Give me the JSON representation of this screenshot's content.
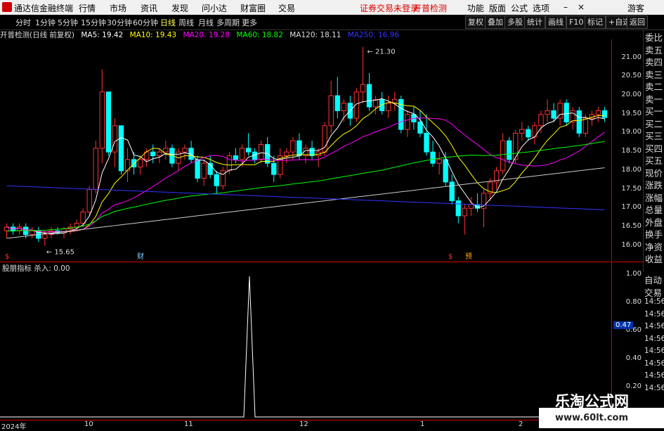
{
  "app": {
    "name": "通达信金融终端",
    "menu": [
      "行情",
      "市场",
      "资讯",
      "发现",
      "问小达",
      "财富圈",
      "交易"
    ],
    "warning": "证券交易未登录",
    "warning2": "开普检测",
    "right_menu": [
      "功能",
      "版面",
      "公式",
      "选项"
    ],
    "guest": "游客"
  },
  "periods": [
    "分时",
    "1分钟",
    "5分钟",
    "15分钟",
    "30分钟",
    "60分钟",
    "日线",
    "周线",
    "月线",
    "多周期",
    "更多"
  ],
  "active_period": "日线",
  "toolbar": [
    "复权",
    "叠加",
    "多股",
    "统计",
    "画线",
    "F10",
    "标记",
    "+自选",
    "返回"
  ],
  "legend": {
    "stock": "开普检测(日线 前复权)",
    "ma5": "MA5: 19.42",
    "ma10": "MA10: 19.43",
    "ma20": "MA20: 19.28",
    "ma60": "MA60: 18.82",
    "ma120": "MA120: 18.11",
    "ma250": "MA250: 16.96",
    "colors": {
      "ma5": "#ffffff",
      "ma10": "#ffff00",
      "ma20": "#ff00ff",
      "ma60": "#00ff00",
      "ma120": "#cccccc",
      "ma250": "#3333ff",
      "up": "#ff3333",
      "down": "#00ffff"
    }
  },
  "price_axis": [
    "21.00",
    "20.50",
    "20.00",
    "19.50",
    "19.00",
    "18.50",
    "18.00",
    "17.50",
    "17.00",
    "16.50",
    "16.00"
  ],
  "annotations": {
    "high": "21.30",
    "low": "15.65"
  },
  "side_labels": [
    "委比",
    "卖五",
    "卖四",
    "卖三",
    "卖二",
    "卖一",
    "买一",
    "买二",
    "买三",
    "买四",
    "买五",
    "现价",
    "涨跌",
    "涨幅",
    "总量",
    "外盘",
    "换手",
    "净资",
    "收益"
  ],
  "side_labels2": [
    "自动",
    "交易",
    "14:56",
    "14:56",
    "14:56",
    "14:56",
    "14:56",
    "14:56",
    "14:56",
    "14:56"
  ],
  "indicator": {
    "legend": "股朋指标  杀入: 0.00",
    "axis": [
      "1.00",
      "0.80",
      "0.60",
      "0.40",
      "0.20"
    ],
    "current": "0.47"
  },
  "x_axis": [
    "2024年",
    "10",
    "11",
    "12",
    "1",
    "2"
  ],
  "markers": {
    "cai": "财",
    "yu": "预",
    "s": "$"
  },
  "watermark": {
    "line1": "乐淘公式网",
    "line2": "www.60lt.com"
  },
  "chart_data": {
    "type": "candlestick",
    "ylim": [
      15.6,
      21.5
    ],
    "candles": [
      [
        16.4,
        16.6,
        16.2,
        16.5
      ],
      [
        16.5,
        16.6,
        16.3,
        16.4
      ],
      [
        16.4,
        16.6,
        16.3,
        16.5
      ],
      [
        16.5,
        16.6,
        16.2,
        16.3
      ],
      [
        16.3,
        16.5,
        16.2,
        16.4
      ],
      [
        16.4,
        16.5,
        16.1,
        16.2
      ],
      [
        16.2,
        16.4,
        16.0,
        16.3
      ],
      [
        16.3,
        16.5,
        16.2,
        16.4
      ],
      [
        16.4,
        16.5,
        16.3,
        16.35
      ],
      [
        16.35,
        16.5,
        16.2,
        16.45
      ],
      [
        16.45,
        16.6,
        16.3,
        16.5
      ],
      [
        16.5,
        16.7,
        16.4,
        16.6
      ],
      [
        16.6,
        17.0,
        16.5,
        16.9
      ],
      [
        16.9,
        17.6,
        16.8,
        17.5
      ],
      [
        17.5,
        18.8,
        17.4,
        18.6
      ],
      [
        18.6,
        20.7,
        18.2,
        20.1
      ],
      [
        20.1,
        19.7,
        18.4,
        18.5
      ],
      [
        18.5,
        19.4,
        18.1,
        19.2
      ],
      [
        19.2,
        18.8,
        17.9,
        18.0
      ],
      [
        18.0,
        18.6,
        17.7,
        18.3
      ],
      [
        18.3,
        18.5,
        17.9,
        18.1
      ],
      [
        18.1,
        18.4,
        17.9,
        18.3
      ],
      [
        18.3,
        18.6,
        18.1,
        18.5
      ],
      [
        18.5,
        18.7,
        18.2,
        18.4
      ],
      [
        18.4,
        18.6,
        18.2,
        18.5
      ],
      [
        18.5,
        18.8,
        18.3,
        18.6
      ],
      [
        18.6,
        18.7,
        18.1,
        18.2
      ],
      [
        18.2,
        18.6,
        18.0,
        18.5
      ],
      [
        18.5,
        18.7,
        18.3,
        18.6
      ],
      [
        18.6,
        18.8,
        18.2,
        18.3
      ],
      [
        18.3,
        18.4,
        17.7,
        17.8
      ],
      [
        17.8,
        18.3,
        17.6,
        18.2
      ],
      [
        18.2,
        18.4,
        17.8,
        17.9
      ],
      [
        17.9,
        18.0,
        17.4,
        17.6
      ],
      [
        17.6,
        18.1,
        17.5,
        18.0
      ],
      [
        18.0,
        18.5,
        17.9,
        18.4
      ],
      [
        18.4,
        18.6,
        18.2,
        18.3
      ],
      [
        18.3,
        18.7,
        18.1,
        18.6
      ],
      [
        18.6,
        19.0,
        18.4,
        18.5
      ],
      [
        18.5,
        18.6,
        18.2,
        18.3
      ],
      [
        18.3,
        18.8,
        18.2,
        18.7
      ],
      [
        18.7,
        18.9,
        18.1,
        18.2
      ],
      [
        18.2,
        18.4,
        17.7,
        17.9
      ],
      [
        17.9,
        18.6,
        17.8,
        18.4
      ],
      [
        18.4,
        18.6,
        18.2,
        18.5
      ],
      [
        18.5,
        18.9,
        18.3,
        18.8
      ],
      [
        18.8,
        19.0,
        18.3,
        18.4
      ],
      [
        18.4,
        18.7,
        18.2,
        18.6
      ],
      [
        18.6,
        18.8,
        18.3,
        18.4
      ],
      [
        18.4,
        18.6,
        18.1,
        18.5
      ],
      [
        18.5,
        19.3,
        18.4,
        19.2
      ],
      [
        19.2,
        20.4,
        19.0,
        20.0
      ],
      [
        20.0,
        20.5,
        19.4,
        19.6
      ],
      [
        19.6,
        19.9,
        19.3,
        19.8
      ],
      [
        19.8,
        20.0,
        19.2,
        19.4
      ],
      [
        19.4,
        20.2,
        19.3,
        20.1
      ],
      [
        20.1,
        21.3,
        19.8,
        20.3
      ],
      [
        20.3,
        20.6,
        19.6,
        19.7
      ],
      [
        19.7,
        20.0,
        19.5,
        19.9
      ],
      [
        19.9,
        20.1,
        19.5,
        19.6
      ],
      [
        19.6,
        20.0,
        19.4,
        19.8
      ],
      [
        19.8,
        20.1,
        19.6,
        19.9
      ],
      [
        19.9,
        20.0,
        19.0,
        19.1
      ],
      [
        19.1,
        19.6,
        18.9,
        19.5
      ],
      [
        19.5,
        19.7,
        19.1,
        19.3
      ],
      [
        19.3,
        19.6,
        18.9,
        19.0
      ],
      [
        19.0,
        19.5,
        18.4,
        18.5
      ],
      [
        18.5,
        18.8,
        18.1,
        18.2
      ],
      [
        18.2,
        18.5,
        17.9,
        18.3
      ],
      [
        18.3,
        18.5,
        17.6,
        17.7
      ],
      [
        17.7,
        17.9,
        17.1,
        17.2
      ],
      [
        17.2,
        17.3,
        16.6,
        16.8
      ],
      [
        16.8,
        17.1,
        16.3,
        17.0
      ],
      [
        17.0,
        17.3,
        16.8,
        17.1
      ],
      [
        17.1,
        17.4,
        16.9,
        17.0
      ],
      [
        17.0,
        17.5,
        16.5,
        17.4
      ],
      [
        17.4,
        17.8,
        17.2,
        17.7
      ],
      [
        17.7,
        18.1,
        17.5,
        18.0
      ],
      [
        18.0,
        19.0,
        17.9,
        18.8
      ],
      [
        18.8,
        18.9,
        18.2,
        18.3
      ],
      [
        18.3,
        19.1,
        18.2,
        19.0
      ],
      [
        19.0,
        19.3,
        18.8,
        19.1
      ],
      [
        19.1,
        19.2,
        18.8,
        18.9
      ],
      [
        18.9,
        19.3,
        18.7,
        19.2
      ],
      [
        19.2,
        19.6,
        19.0,
        19.5
      ],
      [
        19.5,
        19.9,
        19.3,
        19.6
      ],
      [
        19.6,
        19.8,
        19.3,
        19.4
      ],
      [
        19.4,
        19.9,
        19.2,
        19.8
      ],
      [
        19.8,
        19.9,
        19.2,
        19.3
      ],
      [
        19.3,
        19.7,
        19.1,
        19.6
      ],
      [
        19.6,
        19.7,
        18.9,
        19.0
      ],
      [
        19.0,
        19.5,
        18.9,
        19.4
      ],
      [
        19.4,
        19.6,
        19.2,
        19.5
      ],
      [
        19.5,
        19.7,
        19.3,
        19.6
      ],
      [
        19.6,
        19.7,
        19.3,
        19.42
      ]
    ],
    "ma250_start": 17.6,
    "ma250_end": 16.96
  }
}
